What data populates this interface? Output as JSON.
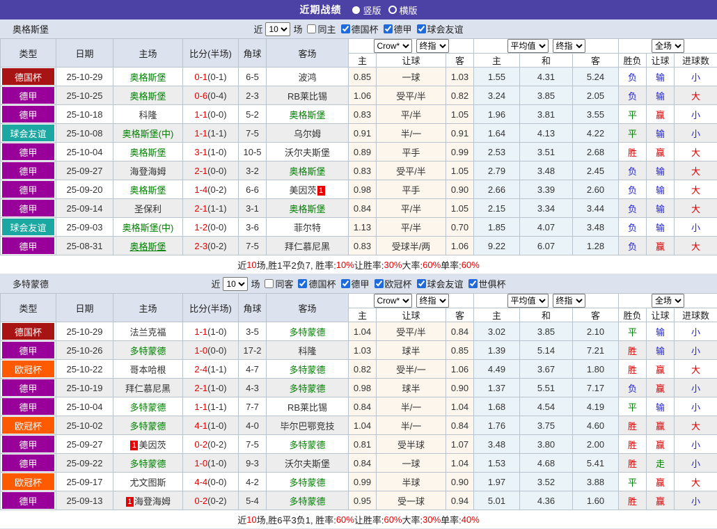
{
  "topbar": {
    "title": "近期战绩",
    "vertical_label": "竖版",
    "horizontal_label": "横版"
  },
  "labels": {
    "near": "近",
    "games": "场"
  },
  "table_header": {
    "static_cols": [
      "类型",
      "日期",
      "主场",
      "比分(半场)",
      "角球",
      "客场"
    ],
    "odds_group_selects": [
      "Crow*",
      "终指"
    ],
    "avg_group_selects": [
      "平均值",
      "终指"
    ],
    "result_group_selects": [
      "全场"
    ],
    "odds_sub": [
      "主",
      "让球",
      "客"
    ],
    "avg_sub": [
      "主",
      "和",
      "客"
    ],
    "result_sub": [
      "胜负",
      "让球",
      "进球数"
    ]
  },
  "type_colors": {
    "德国杯": "#a81414",
    "德甲": "#990099",
    "球会友谊": "#1ba8a2",
    "欧冠杯": "#ff5a00"
  },
  "result_colors": {
    "胜": "#d40000",
    "平": "#008000",
    "负": "#2323d6",
    "赢": "#d40000",
    "走": "#008000",
    "输": "#2323d6",
    "大": "#d40000",
    "小": "#2323d6"
  },
  "sections": [
    {
      "team": "奥格斯堡",
      "recent_count": "10",
      "same_label": "同主",
      "filters": [
        "德国杯",
        "德甲",
        "球会友谊"
      ],
      "rows": [
        {
          "type": "德国杯",
          "date": "25-10-29",
          "home": "奥格斯堡",
          "home_focus": true,
          "score": "0-1",
          "half": "(0-1)",
          "corners": "6-5",
          "away": "波鸿",
          "away_focus": false,
          "odds": [
            "0.85",
            "一球",
            "1.03"
          ],
          "avg": [
            "1.55",
            "4.31",
            "5.24"
          ],
          "results": [
            "负",
            "输",
            "小"
          ]
        },
        {
          "type": "德甲",
          "date": "25-10-25",
          "home": "奥格斯堡",
          "home_focus": true,
          "score": "0-6",
          "half": "(0-4)",
          "corners": "2-3",
          "away": "RB莱比锡",
          "away_focus": false,
          "odds": [
            "1.06",
            "受平/半",
            "0.82"
          ],
          "avg": [
            "3.24",
            "3.85",
            "2.05"
          ],
          "results": [
            "负",
            "输",
            "大"
          ]
        },
        {
          "type": "德甲",
          "date": "25-10-18",
          "home": "科隆",
          "home_focus": false,
          "score": "1-1",
          "half": "(0-0)",
          "corners": "5-2",
          "away": "奥格斯堡",
          "away_focus": true,
          "odds": [
            "0.83",
            "平/半",
            "1.05"
          ],
          "avg": [
            "1.96",
            "3.81",
            "3.55"
          ],
          "results": [
            "平",
            "赢",
            "小"
          ]
        },
        {
          "type": "球会友谊",
          "date": "25-10-08",
          "home": "奥格斯堡(中)",
          "home_focus": true,
          "score": "1-1",
          "half": "(1-1)",
          "corners": "7-5",
          "away": "乌尔姆",
          "away_focus": false,
          "odds": [
            "0.91",
            "半/一",
            "0.91"
          ],
          "avg": [
            "1.64",
            "4.13",
            "4.22"
          ],
          "results": [
            "平",
            "输",
            "小"
          ]
        },
        {
          "type": "德甲",
          "date": "25-10-04",
          "home": "奥格斯堡",
          "home_focus": true,
          "score": "3-1",
          "half": "(1-0)",
          "corners": "10-5",
          "away": "沃尔夫斯堡",
          "away_focus": false,
          "odds": [
            "0.89",
            "平手",
            "0.99"
          ],
          "avg": [
            "2.53",
            "3.51",
            "2.68"
          ],
          "results": [
            "胜",
            "赢",
            "大"
          ]
        },
        {
          "type": "德甲",
          "date": "25-09-27",
          "home": "海登海姆",
          "home_focus": false,
          "score": "2-1",
          "half": "(0-0)",
          "corners": "3-2",
          "away": "奥格斯堡",
          "away_focus": true,
          "odds": [
            "0.83",
            "受平/半",
            "1.05"
          ],
          "avg": [
            "2.79",
            "3.48",
            "2.45"
          ],
          "results": [
            "负",
            "输",
            "大"
          ]
        },
        {
          "type": "德甲",
          "date": "25-09-20",
          "home": "奥格斯堡",
          "home_focus": true,
          "score": "1-4",
          "half": "(0-2)",
          "corners": "6-6",
          "away": "美因茨",
          "away_focus": false,
          "away_badge": "1",
          "away_badge_pos": "after",
          "odds": [
            "0.98",
            "平手",
            "0.90"
          ],
          "avg": [
            "2.66",
            "3.39",
            "2.60"
          ],
          "results": [
            "负",
            "输",
            "大"
          ]
        },
        {
          "type": "德甲",
          "date": "25-09-14",
          "home": "圣保利",
          "home_focus": false,
          "score": "2-1",
          "half": "(1-1)",
          "corners": "3-1",
          "away": "奥格斯堡",
          "away_focus": true,
          "odds": [
            "0.84",
            "平/半",
            "1.05"
          ],
          "avg": [
            "2.15",
            "3.34",
            "3.44"
          ],
          "results": [
            "负",
            "输",
            "大"
          ]
        },
        {
          "type": "球会友谊",
          "date": "25-09-03",
          "home": "奥格斯堡(中)",
          "home_focus": true,
          "score": "1-2",
          "half": "(0-0)",
          "corners": "3-6",
          "away": "菲尔特",
          "away_focus": false,
          "odds": [
            "1.13",
            "平/半",
            "0.70"
          ],
          "avg": [
            "1.85",
            "4.07",
            "3.48"
          ],
          "results": [
            "负",
            "输",
            "小"
          ]
        },
        {
          "type": "德甲",
          "date": "25-08-31",
          "home": "奥格斯堡",
          "home_focus": true,
          "home_underline": true,
          "score": "2-3",
          "half": "(0-2)",
          "corners": "7-5",
          "away": "拜仁慕尼黑",
          "away_focus": false,
          "odds": [
            "0.83",
            "受球半/两",
            "1.06"
          ],
          "avg": [
            "9.22",
            "6.07",
            "1.28"
          ],
          "results": [
            "负",
            "赢",
            "大"
          ]
        }
      ],
      "summary": [
        {
          "text": "近",
          "red": false
        },
        {
          "text": "10",
          "red": true
        },
        {
          "text": "场,胜1平2负7, 胜率:",
          "red": false
        },
        {
          "text": "10%",
          "red": true
        },
        {
          "text": " 让胜率:",
          "red": false
        },
        {
          "text": "30%",
          "red": true
        },
        {
          "text": " 大率:",
          "red": false
        },
        {
          "text": "60%",
          "red": true
        },
        {
          "text": " 单率:",
          "red": false
        },
        {
          "text": "60%",
          "red": true
        }
      ]
    },
    {
      "team": "多特蒙德",
      "recent_count": "10",
      "same_label": "同客",
      "filters": [
        "德国杯",
        "德甲",
        "欧冠杯",
        "球会友谊",
        "世俱杯"
      ],
      "rows": [
        {
          "type": "德国杯",
          "date": "25-10-29",
          "home": "法兰克福",
          "home_focus": false,
          "score": "1-1",
          "half": "(1-0)",
          "corners": "3-5",
          "away": "多特蒙德",
          "away_focus": true,
          "odds": [
            "1.04",
            "受平/半",
            "0.84"
          ],
          "avg": [
            "3.02",
            "3.85",
            "2.10"
          ],
          "results": [
            "平",
            "输",
            "小"
          ]
        },
        {
          "type": "德甲",
          "date": "25-10-26",
          "home": "多特蒙德",
          "home_focus": true,
          "score": "1-0",
          "half": "(0-0)",
          "corners": "17-2",
          "away": "科隆",
          "away_focus": false,
          "odds": [
            "1.03",
            "球半",
            "0.85"
          ],
          "avg": [
            "1.39",
            "5.14",
            "7.21"
          ],
          "results": [
            "胜",
            "输",
            "小"
          ]
        },
        {
          "type": "欧冠杯",
          "date": "25-10-22",
          "home": "哥本哈根",
          "home_focus": false,
          "score": "2-4",
          "half": "(1-1)",
          "corners": "4-7",
          "away": "多特蒙德",
          "away_focus": true,
          "odds": [
            "0.82",
            "受半/一",
            "1.06"
          ],
          "avg": [
            "4.49",
            "3.67",
            "1.80"
          ],
          "results": [
            "胜",
            "赢",
            "大"
          ]
        },
        {
          "type": "德甲",
          "date": "25-10-19",
          "home": "拜仁慕尼黑",
          "home_focus": false,
          "score": "2-1",
          "half": "(1-0)",
          "corners": "4-3",
          "away": "多特蒙德",
          "away_focus": true,
          "odds": [
            "0.98",
            "球半",
            "0.90"
          ],
          "avg": [
            "1.37",
            "5.51",
            "7.17"
          ],
          "results": [
            "负",
            "赢",
            "小"
          ]
        },
        {
          "type": "德甲",
          "date": "25-10-04",
          "home": "多特蒙德",
          "home_focus": true,
          "score": "1-1",
          "half": "(1-1)",
          "corners": "7-7",
          "away": "RB莱比锡",
          "away_focus": false,
          "odds": [
            "0.84",
            "半/一",
            "1.04"
          ],
          "avg": [
            "1.68",
            "4.54",
            "4.19"
          ],
          "results": [
            "平",
            "输",
            "小"
          ]
        },
        {
          "type": "欧冠杯",
          "date": "25-10-02",
          "home": "多特蒙德",
          "home_focus": true,
          "score": "4-1",
          "half": "(1-0)",
          "corners": "4-0",
          "away": "毕尔巴鄂竞技",
          "away_focus": false,
          "odds": [
            "1.04",
            "半/一",
            "0.84"
          ],
          "avg": [
            "1.76",
            "3.75",
            "4.60"
          ],
          "results": [
            "胜",
            "赢",
            "大"
          ]
        },
        {
          "type": "德甲",
          "date": "25-09-27",
          "home": "美因茨",
          "home_focus": false,
          "home_badge": "1",
          "home_badge_pos": "before",
          "score": "0-2",
          "half": "(0-2)",
          "corners": "7-5",
          "away": "多特蒙德",
          "away_focus": true,
          "odds": [
            "0.81",
            "受半球",
            "1.07"
          ],
          "avg": [
            "3.48",
            "3.80",
            "2.00"
          ],
          "results": [
            "胜",
            "赢",
            "小"
          ]
        },
        {
          "type": "德甲",
          "date": "25-09-22",
          "home": "多特蒙德",
          "home_focus": true,
          "score": "1-0",
          "half": "(1-0)",
          "corners": "9-3",
          "away": "沃尔夫斯堡",
          "away_focus": false,
          "odds": [
            "0.84",
            "一球",
            "1.04"
          ],
          "avg": [
            "1.53",
            "4.68",
            "5.41"
          ],
          "results": [
            "胜",
            "走",
            "小"
          ]
        },
        {
          "type": "欧冠杯",
          "date": "25-09-17",
          "home": "尤文图斯",
          "home_focus": false,
          "score": "4-4",
          "half": "(0-0)",
          "corners": "4-2",
          "away": "多特蒙德",
          "away_focus": true,
          "odds": [
            "0.99",
            "半球",
            "0.90"
          ],
          "avg": [
            "1.97",
            "3.52",
            "3.88"
          ],
          "results": [
            "平",
            "赢",
            "大"
          ]
        },
        {
          "type": "德甲",
          "date": "25-09-13",
          "home": "海登海姆",
          "home_focus": false,
          "home_badge": "1",
          "home_badge_pos": "before",
          "score": "0-2",
          "half": "(0-2)",
          "corners": "5-4",
          "away": "多特蒙德",
          "away_focus": true,
          "odds": [
            "0.95",
            "受一球",
            "0.94"
          ],
          "avg": [
            "5.01",
            "4.36",
            "1.60"
          ],
          "results": [
            "胜",
            "赢",
            "小"
          ]
        }
      ],
      "summary": [
        {
          "text": "近",
          "red": false
        },
        {
          "text": "10",
          "red": true
        },
        {
          "text": "场,胜6平3负1, 胜率:",
          "red": false
        },
        {
          "text": "60%",
          "red": true
        },
        {
          "text": " 让胜率:",
          "red": false
        },
        {
          "text": "60%",
          "red": true
        },
        {
          "text": " 大率:",
          "red": false
        },
        {
          "text": "30%",
          "red": true
        },
        {
          "text": " 单率:",
          "red": false
        },
        {
          "text": "40%",
          "red": true
        }
      ]
    }
  ]
}
